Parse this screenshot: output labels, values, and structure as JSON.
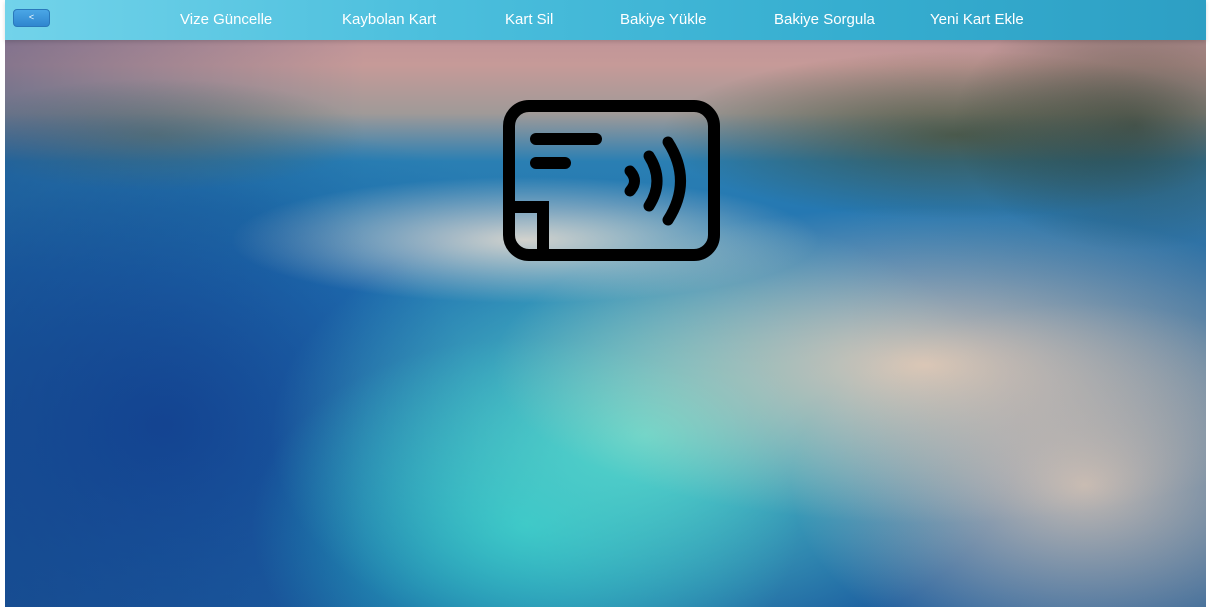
{
  "navbar": {
    "back_label": "<",
    "links": [
      {
        "label": "Vize Güncelle"
      },
      {
        "label": "Kaybolan Kart"
      },
      {
        "label": "Kart Sil"
      },
      {
        "label": "Bakiye Yükle"
      },
      {
        "label": "Bakiye Sorgula"
      },
      {
        "label": "Yeni Kart Ekle"
      }
    ]
  },
  "hero": {
    "icon": "contactless-card-icon",
    "icon_color": "#000000"
  },
  "colors": {
    "navbar_start": "#72d3ea",
    "navbar_end": "#2d9fc4",
    "back_button": "#2f86cf",
    "nav_text": "#ffffff"
  }
}
